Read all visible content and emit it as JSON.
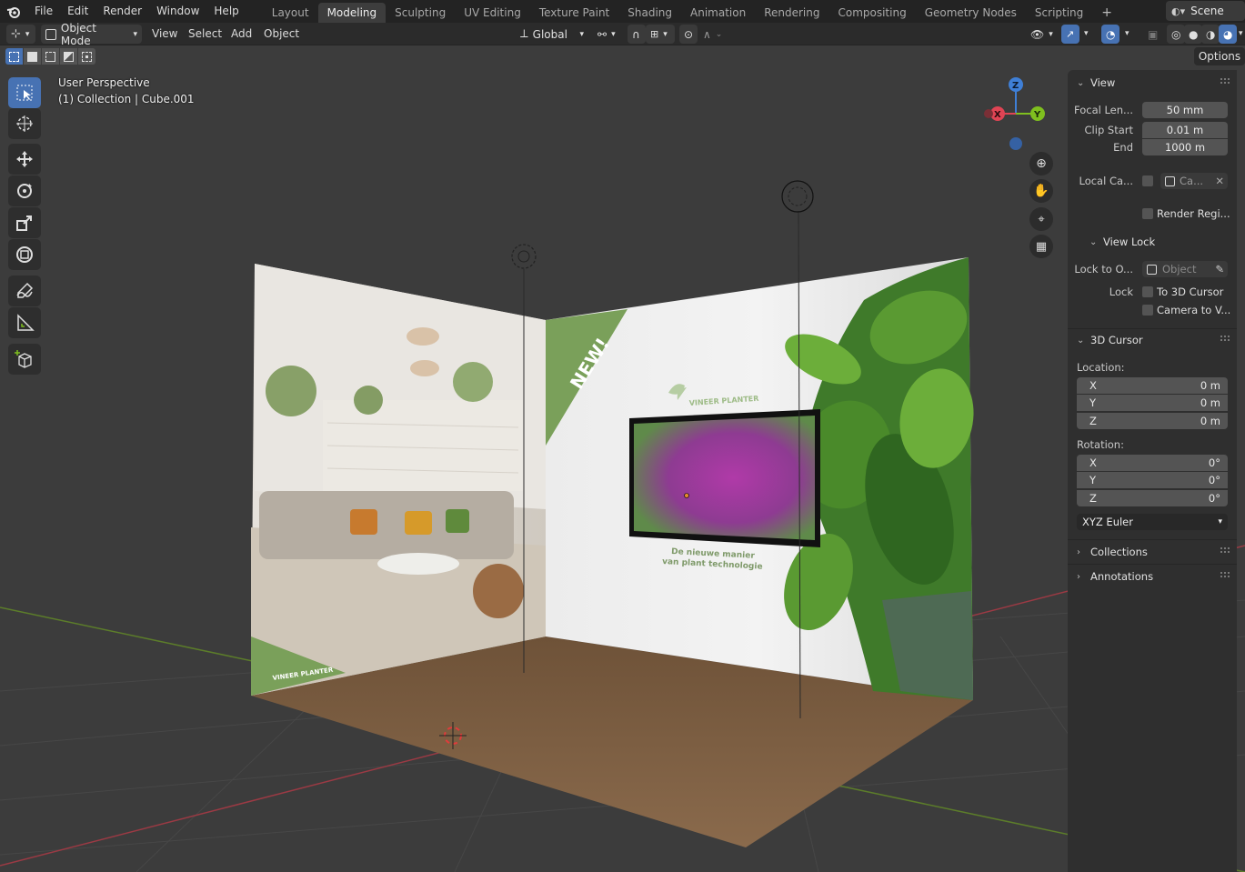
{
  "menu": [
    "File",
    "Edit",
    "Render",
    "Window",
    "Help"
  ],
  "workspaces": [
    "Layout",
    "Modeling",
    "Sculpting",
    "UV Editing",
    "Texture Paint",
    "Shading",
    "Animation",
    "Rendering",
    "Compositing",
    "Geometry Nodes",
    "Scripting"
  ],
  "active_workspace": "Modeling",
  "add_workspace": "+",
  "scene": "Scene",
  "header": {
    "mode": "Object Mode",
    "view": "View",
    "select": "Select",
    "add": "Add",
    "object": "Object",
    "orientation": "Global",
    "options": "Options"
  },
  "viewport": {
    "perspective": "User Perspective",
    "collection": "(1) Collection | Cube.001"
  },
  "gizmo": {
    "x": "X",
    "y": "Y",
    "z": "Z"
  },
  "texture": {
    "badge": "NEW!",
    "brand": "VINEER PLANTER",
    "tagline_1": "De nieuwe manier",
    "tagline_2": "van plant technologie"
  },
  "npanel": {
    "view_title": "View",
    "focal_label": "Focal Len...",
    "focal_value": "50 mm",
    "clip_start_label": "Clip Start",
    "clip_start_value": "0.01 m",
    "clip_end_label": "End",
    "clip_end_value": "1000 m",
    "local_camera_label": "Local Ca...",
    "local_camera_value": "Ca...",
    "render_region": "Render Regi...",
    "view_lock_title": "View Lock",
    "lock_to_label": "Lock to O...",
    "lock_to_placeholder": "Object",
    "lock_label": "Lock",
    "to_cursor": "To 3D Cursor",
    "camera_to_view": "Camera to V...",
    "cursor_title": "3D Cursor",
    "location_label": "Location:",
    "location": [
      {
        "axis": "X",
        "value": "0 m"
      },
      {
        "axis": "Y",
        "value": "0 m"
      },
      {
        "axis": "Z",
        "value": "0 m"
      }
    ],
    "rotation_label": "Rotation:",
    "rotation": [
      {
        "axis": "X",
        "value": "0°"
      },
      {
        "axis": "Y",
        "value": "0°"
      },
      {
        "axis": "Z",
        "value": "0°"
      }
    ],
    "rotation_mode": "XYZ Euler",
    "collections_title": "Collections",
    "annotations_title": "Annotations"
  },
  "colors": {
    "accent": "#4772b3",
    "axis_x": "#e04454",
    "axis_y": "#7fbf1f",
    "axis_z": "#3f7fd6",
    "brand_green": "#7aa05a"
  }
}
